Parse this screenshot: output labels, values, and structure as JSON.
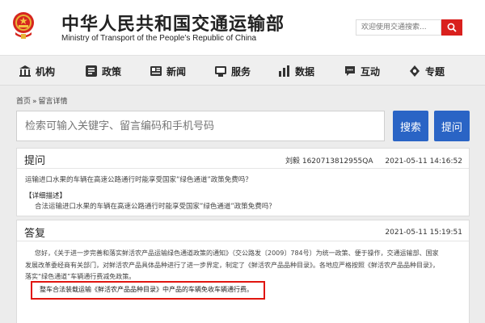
{
  "header": {
    "title_cn": "中华人民共和国交通运输部",
    "title_en": "Ministry of Transport of the People’s Republic of China",
    "search_placeholder": "欢迎使用交通搜索...",
    "accent": "#d9201d"
  },
  "nav": {
    "items": [
      {
        "label": "机构",
        "icon": "building-icon"
      },
      {
        "label": "政策",
        "icon": "policy-icon"
      },
      {
        "label": "新闻",
        "icon": "news-icon"
      },
      {
        "label": "服务",
        "icon": "service-icon"
      },
      {
        "label": "数据",
        "icon": "data-chart-icon"
      },
      {
        "label": "互动",
        "icon": "chat-icon"
      },
      {
        "label": "专题",
        "icon": "topic-icon"
      }
    ]
  },
  "breadcrumb": {
    "home": "首页",
    "sep": "»",
    "current": "留言详情"
  },
  "search": {
    "placeholder": "检索可输入关键字、留言编码和手机号码",
    "search_label": "搜索",
    "ask_label": "提问",
    "button_color": "#2a64c5"
  },
  "question": {
    "title": "提问",
    "author": "刘毅",
    "code": "1620713812955QA",
    "time": "2021-05-11 14:16:52",
    "summary": "运输进口水果的车辆在高速公路通行时能享受国家”绿色通道”政策免费吗？",
    "detail_label": "【详细描述】",
    "detail": "合法运输进口水果的车辆在高速公路通行时能享受国家”绿色通道”政策免费吗？"
  },
  "answer": {
    "title": "答复",
    "time": "2021-05-11 15:19:51",
    "line1": "您好，《关于进一步完善和落实鲜活农产品运输绿色通道政策的通知》（交公路发〔2009〕784号）为统一政策、便于操作，交通运输部、国家",
    "line2": "发展改革委经商有关部门，对鲜活农产品具体品种进行了进一步界定，制定了《鲜活农产品品种目录》。各地应严格按照《鲜活农产品品种目录》，",
    "line3": "落实“绿色通道”车辆通行费减免政策。",
    "highlight": "整车合法装载运输《鲜活农产品品种目录》中产品的车辆免收车辆通行费。",
    "highlight_color": "#e0150f"
  }
}
